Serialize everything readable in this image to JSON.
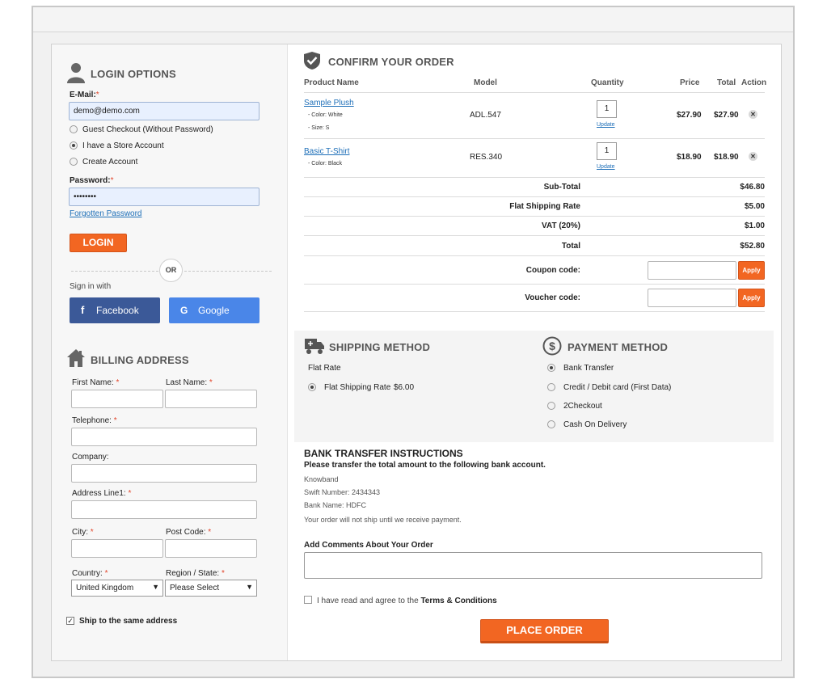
{
  "login": {
    "heading": "LOGIN OPTIONS",
    "email_label": "E-Mail:",
    "email_value": "demo@demo.com",
    "options": [
      "Guest Checkout (Without Password)",
      "I have a Store Account",
      "Create Account"
    ],
    "selected_option": "I have a Store Account",
    "password_label": "Password:",
    "password_value": "••••••••",
    "forgot_link": "Forgotten Password",
    "login_button": "LOGIN",
    "or_text": "OR",
    "sign_in_with": "Sign in with",
    "facebook_button": "Facebook",
    "google_button": "Google"
  },
  "billing": {
    "heading": "BILLING ADDRESS",
    "first_name": "First Name:",
    "last_name": "Last Name:",
    "telephone": "Telephone:",
    "company": "Company:",
    "address1": "Address Line1:",
    "city": "City:",
    "post_code": "Post Code:",
    "country": "Country:",
    "country_value": "United Kingdom",
    "region": "Region / State:",
    "region_value": "Please Select",
    "ship_same": "Ship to the same address",
    "required_mark": "*"
  },
  "order": {
    "heading": "CONFIRM YOUR ORDER",
    "columns": {
      "product": "Product Name",
      "model": "Model",
      "quantity": "Quantity",
      "price": "Price",
      "total": "Total",
      "action": "Action"
    },
    "items": [
      {
        "name": "Sample Plush",
        "options": [
          "- Color: White",
          "- Size: S"
        ],
        "model": "ADL.547",
        "qty": "1",
        "update": "Update",
        "price": "$27.90",
        "total": "$27.90"
      },
      {
        "name": "Basic T-Shirt",
        "options": [
          "- Color: Black"
        ],
        "model": "RES.340",
        "qty": "1",
        "update": "Update",
        "price": "$18.90",
        "total": "$18.90"
      }
    ],
    "totals": [
      {
        "label": "Sub-Total",
        "value": "$46.80"
      },
      {
        "label": "Flat Shipping Rate",
        "value": "$5.00"
      },
      {
        "label": "VAT (20%)",
        "value": "$1.00"
      },
      {
        "label": "Total",
        "value": "$52.80"
      }
    ],
    "coupon_label": "Coupon code:",
    "voucher_label": "Voucher code:",
    "apply": "Apply"
  },
  "shipping": {
    "heading": "SHIPPING METHOD",
    "group": "Flat Rate",
    "option": "Flat Shipping Rate",
    "price": "$6.00"
  },
  "payment": {
    "heading": "PAYMENT METHOD",
    "options": [
      "Bank Transfer",
      "Credit / Debit card (First Data)",
      "2Checkout",
      "Cash On Delivery"
    ],
    "selected": "Bank Transfer"
  },
  "bank": {
    "heading": "BANK TRANSFER INSTRUCTIONS",
    "subheading": "Please transfer the total amount to the following bank account.",
    "lines": [
      "Knowband",
      "Swift Number: 2434343",
      "Bank Name: HDFC",
      "Your order will not ship until we receive payment."
    ]
  },
  "comments_label": "Add Comments About Your Order",
  "terms_prefix": "I have read and agree to the",
  "terms_link": "Terms & Conditions",
  "place_order": "PLACE ORDER",
  "colors": {
    "accent": "#f26622",
    "facebook": "#3b5998",
    "google": "#4a86e8",
    "link": "#1e6fb8"
  }
}
